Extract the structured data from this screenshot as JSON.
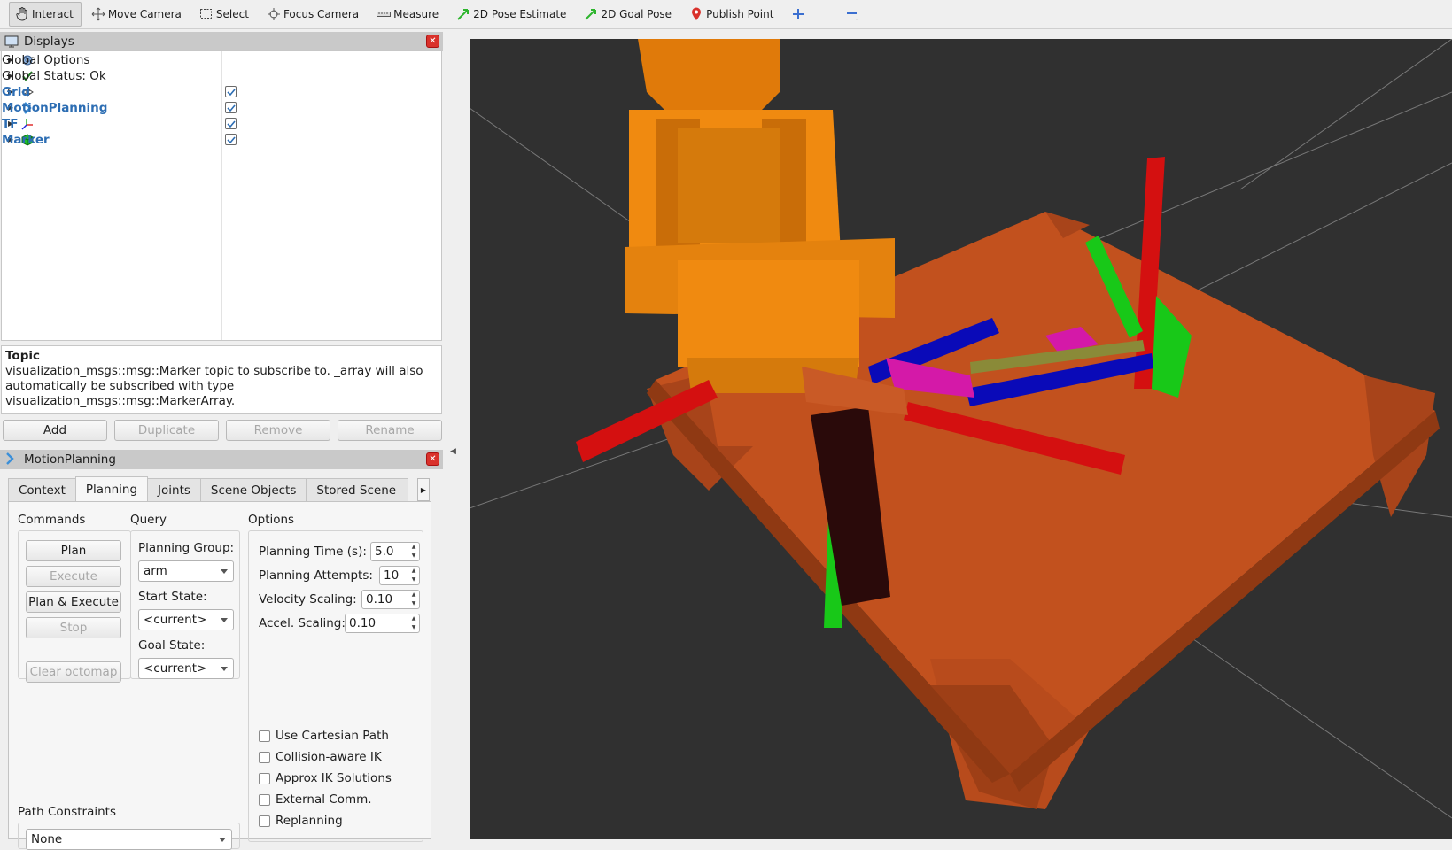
{
  "toolbar": {
    "tools": [
      {
        "label": "Interact",
        "icon": "hand-icon"
      },
      {
        "label": "Move Camera",
        "icon": "move-icon"
      },
      {
        "label": "Select",
        "icon": "select-icon"
      },
      {
        "label": "Focus Camera",
        "icon": "focus-icon"
      },
      {
        "label": "Measure",
        "icon": "ruler-icon"
      },
      {
        "label": "2D Pose Estimate",
        "icon": "green-arrow-icon"
      },
      {
        "label": "2D Goal Pose",
        "icon": "green-arrow-icon"
      },
      {
        "label": "Publish Point",
        "icon": "map-pin-icon"
      }
    ],
    "add_icon": "plus-icon",
    "remove_icon": "minus-icon"
  },
  "displays": {
    "title": "Displays",
    "items": [
      {
        "label": "Global Options",
        "icon": "gear-icon",
        "checked": null
      },
      {
        "label": "Global Status: Ok",
        "icon": "checkmark-icon",
        "checked": null
      },
      {
        "label": "Grid",
        "icon": "grid-icon",
        "checked": true
      },
      {
        "label": "MotionPlanning",
        "icon": "motion-planning-icon",
        "checked": true
      },
      {
        "label": "TF",
        "icon": "axes-icon",
        "checked": true
      },
      {
        "label": "Marker",
        "icon": "green-cube-icon",
        "checked": true
      }
    ],
    "help_title": "Topic",
    "help_text": "visualization_msgs::msg::Marker topic to subscribe to. _array will also automatically be subscribed with type visualization_msgs::msg::MarkerArray.",
    "buttons": {
      "add": "Add",
      "duplicate": "Duplicate",
      "remove": "Remove",
      "rename": "Rename"
    }
  },
  "motion_planning": {
    "title": "MotionPlanning",
    "tabs": [
      "Context",
      "Planning",
      "Joints",
      "Scene Objects",
      "Stored Scene"
    ],
    "active_tab": "Planning",
    "commands": {
      "title": "Commands",
      "plan": "Plan",
      "execute": "Execute",
      "plan_execute": "Plan & Execute",
      "stop": "Stop",
      "clear_octomap": "Clear octomap"
    },
    "query": {
      "title": "Query",
      "planning_group_label": "Planning Group:",
      "planning_group": "arm",
      "start_state_label": "Start State:",
      "start_state": "<current>",
      "goal_state_label": "Goal State:",
      "goal_state": "<current>"
    },
    "options": {
      "title": "Options",
      "planning_time_label": "Planning Time (s):",
      "planning_time": "5.0",
      "planning_attempts_label": "Planning Attempts:",
      "planning_attempts": "10",
      "velocity_label": "Velocity Scaling:",
      "velocity": "0.10",
      "accel_label": "Accel. Scaling:",
      "accel": "0.10",
      "checkboxes": [
        "Use Cartesian Path",
        "Collision-aware IK",
        "Approx IK Solutions",
        "External Comm.",
        "Replanning"
      ]
    },
    "path_constraints_label": "Path Constraints",
    "path_constraints": "None"
  },
  "colors": {
    "robot_orange": "#f08a10",
    "table_brown": "#c2511e",
    "background": "#303030",
    "accent_blue": "#2c6db3"
  }
}
